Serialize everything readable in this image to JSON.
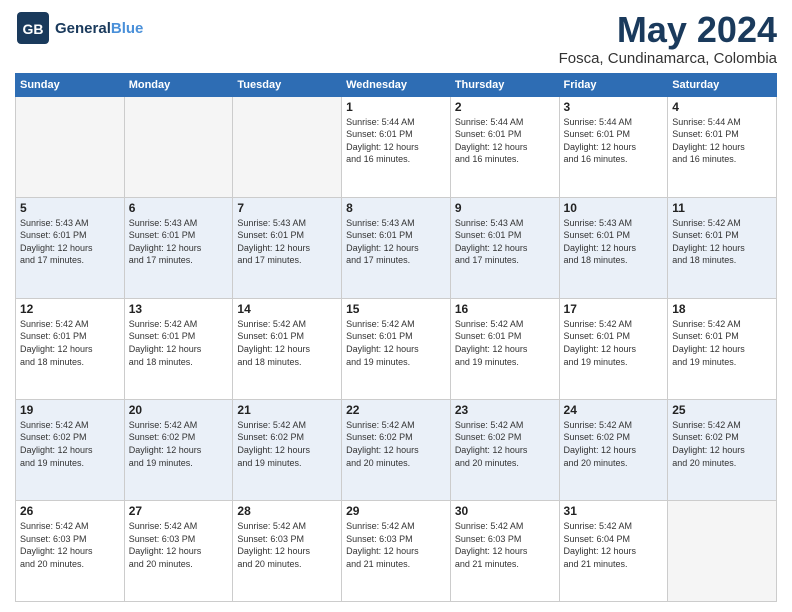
{
  "logo": {
    "text1": "General",
    "text2": "Blue"
  },
  "title": "May 2024",
  "location": "Fosca, Cundinamarca, Colombia",
  "days_of_week": [
    "Sunday",
    "Monday",
    "Tuesday",
    "Wednesday",
    "Thursday",
    "Friday",
    "Saturday"
  ],
  "weeks": [
    {
      "shade": false,
      "days": [
        {
          "number": "",
          "info": ""
        },
        {
          "number": "",
          "info": ""
        },
        {
          "number": "",
          "info": ""
        },
        {
          "number": "1",
          "info": "Sunrise: 5:44 AM\nSunset: 6:01 PM\nDaylight: 12 hours\nand 16 minutes."
        },
        {
          "number": "2",
          "info": "Sunrise: 5:44 AM\nSunset: 6:01 PM\nDaylight: 12 hours\nand 16 minutes."
        },
        {
          "number": "3",
          "info": "Sunrise: 5:44 AM\nSunset: 6:01 PM\nDaylight: 12 hours\nand 16 minutes."
        },
        {
          "number": "4",
          "info": "Sunrise: 5:44 AM\nSunset: 6:01 PM\nDaylight: 12 hours\nand 16 minutes."
        }
      ]
    },
    {
      "shade": true,
      "days": [
        {
          "number": "5",
          "info": "Sunrise: 5:43 AM\nSunset: 6:01 PM\nDaylight: 12 hours\nand 17 minutes."
        },
        {
          "number": "6",
          "info": "Sunrise: 5:43 AM\nSunset: 6:01 PM\nDaylight: 12 hours\nand 17 minutes."
        },
        {
          "number": "7",
          "info": "Sunrise: 5:43 AM\nSunset: 6:01 PM\nDaylight: 12 hours\nand 17 minutes."
        },
        {
          "number": "8",
          "info": "Sunrise: 5:43 AM\nSunset: 6:01 PM\nDaylight: 12 hours\nand 17 minutes."
        },
        {
          "number": "9",
          "info": "Sunrise: 5:43 AM\nSunset: 6:01 PM\nDaylight: 12 hours\nand 17 minutes."
        },
        {
          "number": "10",
          "info": "Sunrise: 5:43 AM\nSunset: 6:01 PM\nDaylight: 12 hours\nand 18 minutes."
        },
        {
          "number": "11",
          "info": "Sunrise: 5:42 AM\nSunset: 6:01 PM\nDaylight: 12 hours\nand 18 minutes."
        }
      ]
    },
    {
      "shade": false,
      "days": [
        {
          "number": "12",
          "info": "Sunrise: 5:42 AM\nSunset: 6:01 PM\nDaylight: 12 hours\nand 18 minutes."
        },
        {
          "number": "13",
          "info": "Sunrise: 5:42 AM\nSunset: 6:01 PM\nDaylight: 12 hours\nand 18 minutes."
        },
        {
          "number": "14",
          "info": "Sunrise: 5:42 AM\nSunset: 6:01 PM\nDaylight: 12 hours\nand 18 minutes."
        },
        {
          "number": "15",
          "info": "Sunrise: 5:42 AM\nSunset: 6:01 PM\nDaylight: 12 hours\nand 19 minutes."
        },
        {
          "number": "16",
          "info": "Sunrise: 5:42 AM\nSunset: 6:01 PM\nDaylight: 12 hours\nand 19 minutes."
        },
        {
          "number": "17",
          "info": "Sunrise: 5:42 AM\nSunset: 6:01 PM\nDaylight: 12 hours\nand 19 minutes."
        },
        {
          "number": "18",
          "info": "Sunrise: 5:42 AM\nSunset: 6:01 PM\nDaylight: 12 hours\nand 19 minutes."
        }
      ]
    },
    {
      "shade": true,
      "days": [
        {
          "number": "19",
          "info": "Sunrise: 5:42 AM\nSunset: 6:02 PM\nDaylight: 12 hours\nand 19 minutes."
        },
        {
          "number": "20",
          "info": "Sunrise: 5:42 AM\nSunset: 6:02 PM\nDaylight: 12 hours\nand 19 minutes."
        },
        {
          "number": "21",
          "info": "Sunrise: 5:42 AM\nSunset: 6:02 PM\nDaylight: 12 hours\nand 19 minutes."
        },
        {
          "number": "22",
          "info": "Sunrise: 5:42 AM\nSunset: 6:02 PM\nDaylight: 12 hours\nand 20 minutes."
        },
        {
          "number": "23",
          "info": "Sunrise: 5:42 AM\nSunset: 6:02 PM\nDaylight: 12 hours\nand 20 minutes."
        },
        {
          "number": "24",
          "info": "Sunrise: 5:42 AM\nSunset: 6:02 PM\nDaylight: 12 hours\nand 20 minutes."
        },
        {
          "number": "25",
          "info": "Sunrise: 5:42 AM\nSunset: 6:02 PM\nDaylight: 12 hours\nand 20 minutes."
        }
      ]
    },
    {
      "shade": false,
      "days": [
        {
          "number": "26",
          "info": "Sunrise: 5:42 AM\nSunset: 6:03 PM\nDaylight: 12 hours\nand 20 minutes."
        },
        {
          "number": "27",
          "info": "Sunrise: 5:42 AM\nSunset: 6:03 PM\nDaylight: 12 hours\nand 20 minutes."
        },
        {
          "number": "28",
          "info": "Sunrise: 5:42 AM\nSunset: 6:03 PM\nDaylight: 12 hours\nand 20 minutes."
        },
        {
          "number": "29",
          "info": "Sunrise: 5:42 AM\nSunset: 6:03 PM\nDaylight: 12 hours\nand 21 minutes."
        },
        {
          "number": "30",
          "info": "Sunrise: 5:42 AM\nSunset: 6:03 PM\nDaylight: 12 hours\nand 21 minutes."
        },
        {
          "number": "31",
          "info": "Sunrise: 5:42 AM\nSunset: 6:04 PM\nDaylight: 12 hours\nand 21 minutes."
        },
        {
          "number": "",
          "info": ""
        }
      ]
    }
  ]
}
